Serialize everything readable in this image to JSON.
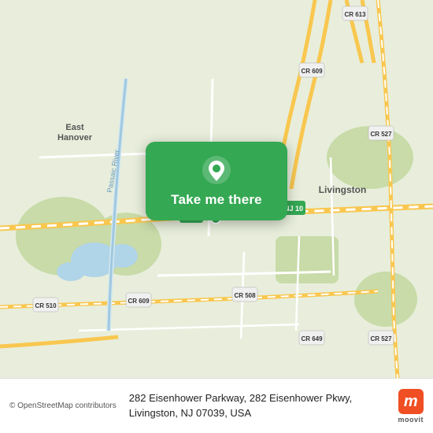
{
  "map": {
    "alt": "Map showing 282 Eisenhower Parkway, Livingston NJ area"
  },
  "card": {
    "button_label": "Take me there"
  },
  "bottom_bar": {
    "osm_credit": "© OpenStreetMap contributors",
    "address_line1": "282 Eisenhower Parkway, 282 Eisenhower Pkwy,",
    "address_line2": "Livingston, NJ 07039, USA",
    "moovit_label": "moovit"
  }
}
